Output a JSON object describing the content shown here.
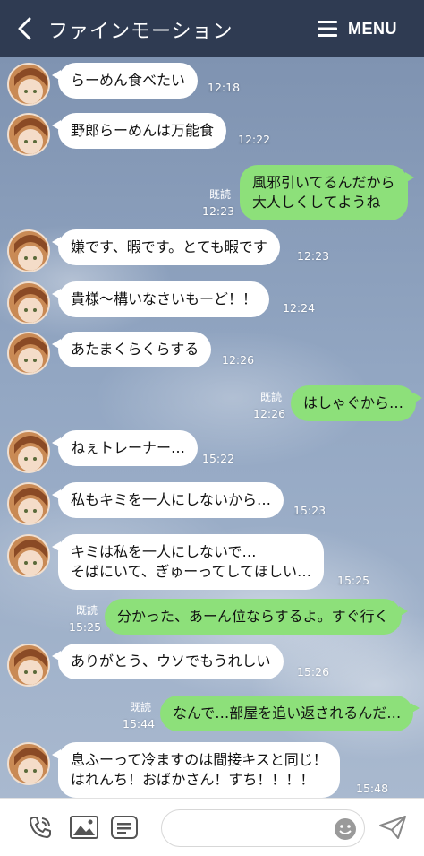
{
  "header": {
    "title": "ファインモーション",
    "menu_label": "MENU"
  },
  "read_label": "既読",
  "messages": [
    {
      "side": "in",
      "text": "らーめん食べたい",
      "time": "12:18"
    },
    {
      "side": "in",
      "text": "野郎らーめんは万能食",
      "time": "12:22"
    },
    {
      "side": "out",
      "text": "風邪引いてるんだから\n大人しくしてようね",
      "time": "12:23",
      "read": true
    },
    {
      "side": "in",
      "text": "嫌です、暇です。とても暇です",
      "time": "12:23"
    },
    {
      "side": "in",
      "text": "貴様〜構いなさいもーど！！",
      "time": "12:24"
    },
    {
      "side": "in",
      "text": "あたまくらくらする",
      "time": "12:26"
    },
    {
      "side": "out",
      "text": "はしゃぐから…",
      "time": "12:26",
      "read": true
    },
    {
      "side": "in",
      "text": "ねぇトレーナー…",
      "time": "15:22"
    },
    {
      "side": "in",
      "text": "私もキミを一人にしないから…",
      "time": "15:23"
    },
    {
      "side": "in",
      "text": "キミは私を一人にしないで…\nそばにいて、ぎゅーってしてほしい…",
      "time": "15:25"
    },
    {
      "side": "out",
      "text": "分かった、あーん位ならするよ。すぐ行く",
      "time": "15:25",
      "read": true
    },
    {
      "side": "in",
      "text": "ありがとう、ウソでもうれしい",
      "time": "15:26"
    },
    {
      "side": "out",
      "text": "なんで…部屋を追い返されるんだ…",
      "time": "15:44",
      "read": true
    },
    {
      "side": "in",
      "text": "息ふーって冷ますのは間接キスと同じ！\nはれんち！おばかさん！すち！！！！",
      "time": "15:48"
    }
  ],
  "colors": {
    "header_bg": "#2f3b52",
    "outgoing_bubble": "#8de07a",
    "incoming_bubble": "#ffffff"
  },
  "icons": {
    "back": "chevron-left-icon",
    "menu": "hamburger-icon",
    "call": "phone-icon",
    "image": "image-icon",
    "keyboard": "keyboard-icon",
    "emoji": "smiley-icon",
    "send": "send-icon"
  }
}
